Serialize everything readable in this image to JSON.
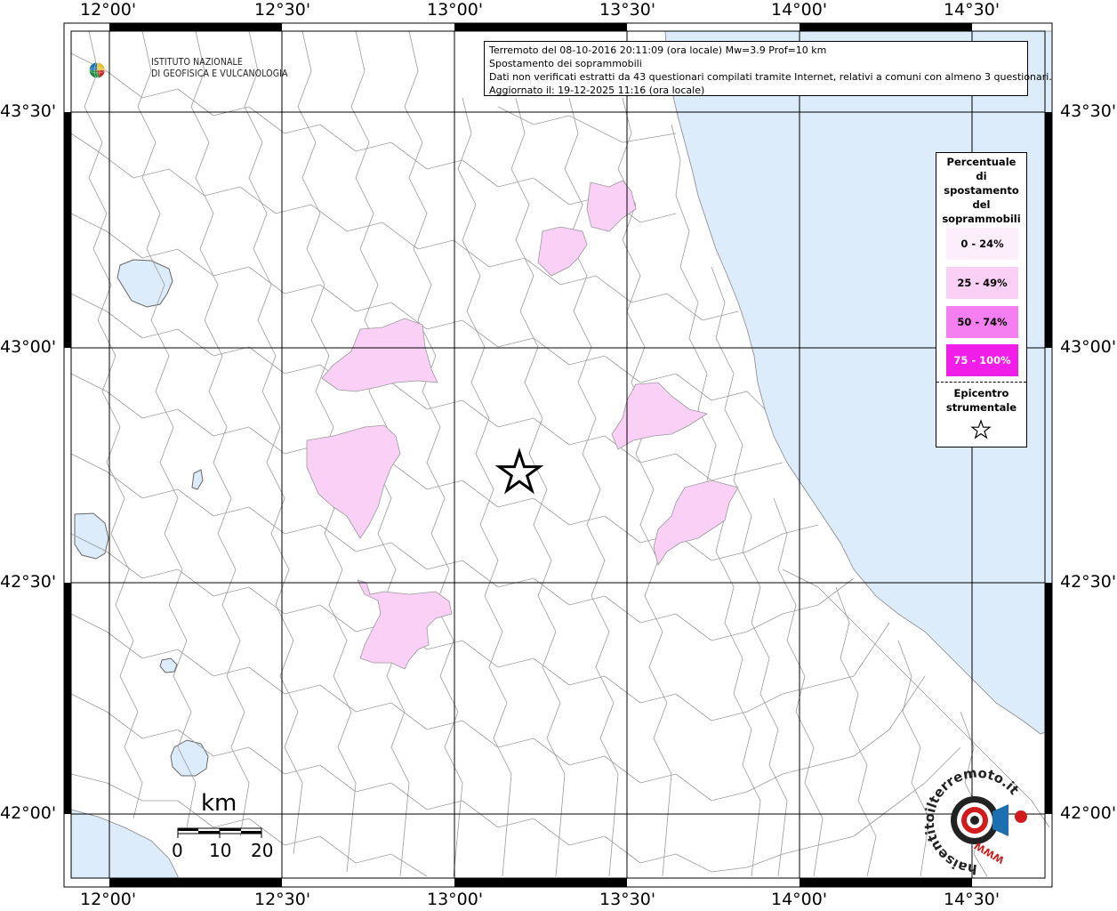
{
  "info": {
    "line1": "Terremoto del 08-10-2016 20:11:09 (ora locale) Mw=3.9 Prof=10 km",
    "line2": "Spostamento dei soprammobili",
    "line3": "Dati non verificati estratti da 43 questionari compilati tramite Internet, relativi a comuni con almeno 3 questionari.",
    "line4": "Aggiornato il: 19-12-2025 11:16 (ora locale)"
  },
  "ingv": {
    "line1": "ISTITUTO NAZIONALE",
    "line2": "DI GEOFISICA E VULCANOLOGIA"
  },
  "lon_ticks": [
    "12°00'",
    "12°30'",
    "13°00'",
    "13°30'",
    "14°00'",
    "14°30'"
  ],
  "lat_ticks": [
    "43°30'",
    "43°00'",
    "42°30'",
    "42°00'"
  ],
  "legend": {
    "title": [
      "Percentuale",
      "di",
      "spostamento",
      "del",
      "soprammobili"
    ],
    "classes": [
      {
        "label": "0 - 24%",
        "color": "#fdeefb"
      },
      {
        "label": "25 - 49%",
        "color": "#fbd0f6"
      },
      {
        "label": "50 - 74%",
        "color": "#f57ef0"
      },
      {
        "label": "75 - 100%",
        "color": "#f01ee8"
      }
    ],
    "epicenter": [
      "Epicentro",
      "strumentale"
    ]
  },
  "scale": {
    "unit": "km",
    "labels": [
      "0",
      "10",
      "20"
    ]
  },
  "hsit": {
    "text": "haisentitoilterremoto.it",
    "www": "WWW"
  },
  "colors": {
    "sea": "#dcecfa",
    "land": "#ffffff",
    "border_lines": "#9a9a9a",
    "grid": "#000000",
    "class_25_49": "#fbd0f6"
  },
  "epicenter": {
    "lon": 13.19,
    "lat": 42.75
  }
}
